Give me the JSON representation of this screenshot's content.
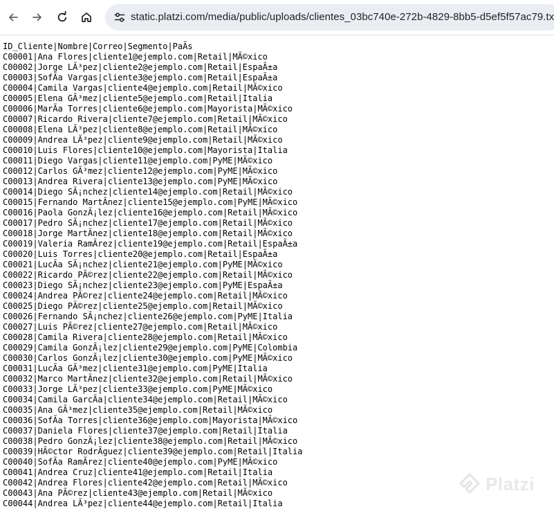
{
  "browser": {
    "url": "static.platzi.com/media/public/uploads/clientes_03bc740e-272b-4829-8bb5-d5ef5f57ac79.txt",
    "icons": {
      "back": "back-arrow-icon",
      "forward": "forward-arrow-icon",
      "reload": "reload-icon",
      "home": "home-icon",
      "site_info": "tune-icon"
    }
  },
  "document": {
    "lines": [
      "ID_Cliente|Nombre|Correo|Segmento|PaÃs",
      "C00001|Ana Flores|cliente1@ejemplo.com|Retail|MÃ©xico",
      "C00002|Jorge LÃ³pez|cliente2@ejemplo.com|Retail|EspaÃ±a",
      "C00003|SofÃa Vargas|cliente3@ejemplo.com|Retail|EspaÃ±a",
      "C00004|Camila Vargas|cliente4@ejemplo.com|Retail|MÃ©xico",
      "C00005|Elena GÃ³mez|cliente5@ejemplo.com|Retail|Italia",
      "C00006|MarÃa Torres|cliente6@ejemplo.com|Mayorista|MÃ©xico",
      "C00007|Ricardo Rivera|cliente7@ejemplo.com|Retail|MÃ©xico",
      "C00008|Elena LÃ³pez|cliente8@ejemplo.com|Retail|MÃ©xico",
      "C00009|Andrea LÃ³pez|cliente9@ejemplo.com|Retail|MÃ©xico",
      "C00010|Luis Flores|cliente10@ejemplo.com|Mayorista|Italia",
      "C00011|Diego Vargas|cliente11@ejemplo.com|PyME|MÃ©xico",
      "C00012|Carlos GÃ³mez|cliente12@ejemplo.com|PyME|MÃ©xico",
      "C00013|Andrea Rivera|cliente13@ejemplo.com|PyME|MÃ©xico",
      "C00014|Diego SÃ¡nchez|cliente14@ejemplo.com|Retail|MÃ©xico",
      "C00015|Fernando MartÃnez|cliente15@ejemplo.com|PyME|MÃ©xico",
      "C00016|Paola GonzÃ¡lez|cliente16@ejemplo.com|Retail|MÃ©xico",
      "C00017|Pedro SÃ¡nchez|cliente17@ejemplo.com|Retail|MÃ©xico",
      "C00018|Jorge MartÃnez|cliente18@ejemplo.com|Retail|MÃ©xico",
      "C00019|Valeria RamÃrez|cliente19@ejemplo.com|Retail|EspaÃ±a",
      "C00020|Luis Torres|cliente20@ejemplo.com|Retail|EspaÃ±a",
      "C00021|LucÃa SÃ¡nchez|cliente21@ejemplo.com|PyME|MÃ©xico",
      "C00022|Ricardo PÃ©rez|cliente22@ejemplo.com|Retail|MÃ©xico",
      "C00023|Diego SÃ¡nchez|cliente23@ejemplo.com|PyME|EspaÃ±a",
      "C00024|Andrea PÃ©rez|cliente24@ejemplo.com|Retail|MÃ©xico",
      "C00025|Diego PÃ©rez|cliente25@ejemplo.com|Retail|MÃ©xico",
      "C00026|Fernando SÃ¡nchez|cliente26@ejemplo.com|PyME|Italia",
      "C00027|Luis PÃ©rez|cliente27@ejemplo.com|Retail|MÃ©xico",
      "C00028|Camila Rivera|cliente28@ejemplo.com|Retail|MÃ©xico",
      "C00029|Camila GonzÃ¡lez|cliente29@ejemplo.com|PyME|Colombia",
      "C00030|Carlos GonzÃ¡lez|cliente30@ejemplo.com|PyME|MÃ©xico",
      "C00031|LucÃa GÃ³mez|cliente31@ejemplo.com|PyME|Italia",
      "C00032|Marco MartÃnez|cliente32@ejemplo.com|Retail|MÃ©xico",
      "C00033|Jorge LÃ³pez|cliente33@ejemplo.com|PyME|MÃ©xico",
      "C00034|Camila GarcÃa|cliente34@ejemplo.com|Retail|MÃ©xico",
      "C00035|Ana GÃ³mez|cliente35@ejemplo.com|Retail|MÃ©xico",
      "C00036|SofÃa Torres|cliente36@ejemplo.com|Mayorista|MÃ©xico",
      "C00037|Daniela Flores|cliente37@ejemplo.com|Retail|Italia",
      "C00038|Pedro GonzÃ¡lez|cliente38@ejemplo.com|Retail|MÃ©xico",
      "C00039|HÃ©ctor RodrÃguez|cliente39@ejemplo.com|Retail|Italia",
      "C00040|SofÃa RamÃrez|cliente40@ejemplo.com|PyME|MÃ©xico",
      "C00041|Andrea Cruz|cliente41@ejemplo.com|Retail|Italia",
      "C00042|Andrea Flores|cliente42@ejemplo.com|Retail|MÃ©xico",
      "C00043|Ana PÃ©rez|cliente43@ejemplo.com|Retail|MÃ©xico",
      "C00044|Andrea LÃ³pez|cliente44@ejemplo.com|Retail|Italia"
    ]
  },
  "watermark": {
    "text": "Platzi"
  }
}
